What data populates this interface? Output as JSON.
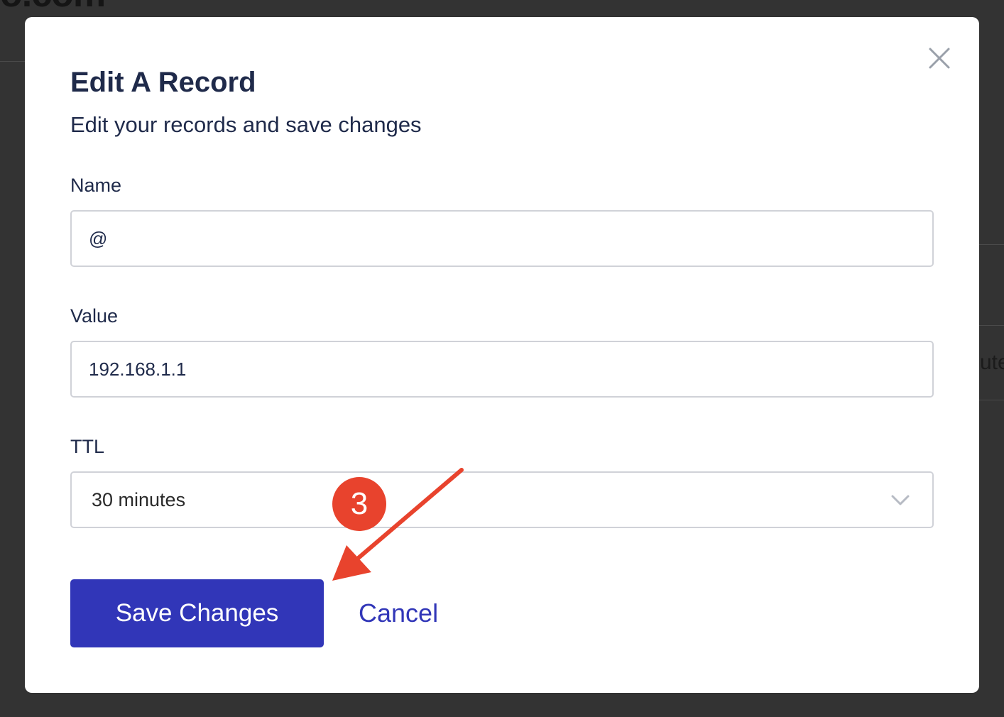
{
  "background": {
    "heading_fragment": "o.com",
    "row_text_fragment": "ute"
  },
  "modal": {
    "title": "Edit A Record",
    "subtitle": "Edit your records and save changes",
    "close_icon": "close-icon",
    "fields": {
      "name": {
        "label": "Name",
        "value": "@"
      },
      "value": {
        "label": "Value",
        "value": "192.168.1.1"
      },
      "ttl": {
        "label": "TTL",
        "selected": "30 minutes",
        "icon": "chevron-down-icon"
      }
    },
    "actions": {
      "save_label": "Save Changes",
      "cancel_label": "Cancel"
    }
  },
  "annotation": {
    "step_number": "3",
    "color": "#e8432d"
  },
  "colors": {
    "overlay": "#333333",
    "primary": "#3136b8",
    "text": "#1f2a4a",
    "border": "#d0d2d8"
  }
}
